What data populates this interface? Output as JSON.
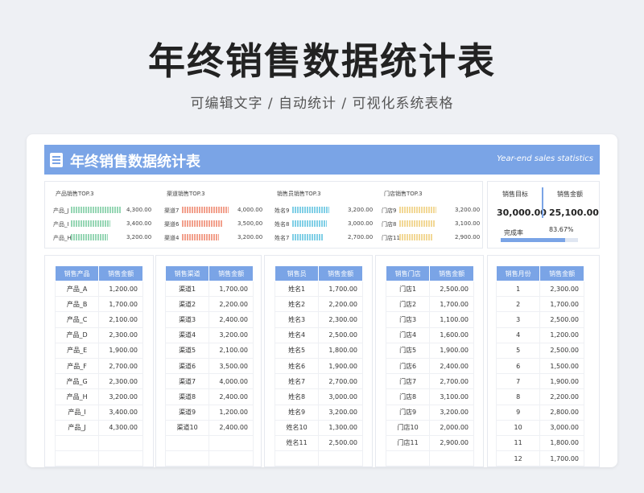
{
  "hero": {
    "title": "年终销售数据统计表",
    "subtitle": "可编辑文字 / 自动统计 / 可视化系统表格"
  },
  "banner": {
    "title": "年终销售数据统计表",
    "subtitle_en": "Year-end sales statistics",
    "icon": "report-icon",
    "color": "#7aa4e6"
  },
  "top_charts": [
    {
      "title": "产品销售TOP.3",
      "color": "#96d6b4",
      "items": [
        {
          "label": "产品_J",
          "value": "4,300.00",
          "amount": 4300
        },
        {
          "label": "产品_I",
          "value": "3,400.00",
          "amount": 3400
        },
        {
          "label": "产品_H",
          "value": "3,200.00",
          "amount": 3200
        }
      ]
    },
    {
      "title": "渠道销售TOP.3",
      "color": "#f2a08c",
      "items": [
        {
          "label": "渠道7",
          "value": "4,000.00",
          "amount": 4000
        },
        {
          "label": "渠道6",
          "value": "3,500,00",
          "amount": 3500
        },
        {
          "label": "渠道4",
          "value": "3,200.00",
          "amount": 3200
        }
      ]
    },
    {
      "title": "销售员销售TOP.3",
      "color": "#80cfe6",
      "items": [
        {
          "label": "姓名9",
          "value": "3,200.00",
          "amount": 3200
        },
        {
          "label": "姓名8",
          "value": "3,000.00",
          "amount": 3000
        },
        {
          "label": "姓名7",
          "value": "2,700.00",
          "amount": 2700
        }
      ]
    },
    {
      "title": "门店销售TOP.3",
      "color": "#f2d896",
      "items": [
        {
          "label": "门店9",
          "value": "3,200.00",
          "amount": 3200
        },
        {
          "label": "门店8",
          "value": "3,100.00",
          "amount": 3100
        },
        {
          "label": "门店11",
          "value": "2,900.00",
          "amount": 2900
        }
      ]
    }
  ],
  "kpi": {
    "target_label": "销售目标",
    "target_value": "30,000.00",
    "amount_label": "销售金额",
    "amount_value": "25,100.00",
    "rate_label": "完成率",
    "rate_value": "83.67%",
    "rate_fraction": 0.8367
  },
  "tables": [
    {
      "headers": [
        "销售产品",
        "销售金额"
      ],
      "rows": [
        [
          "产品_A",
          "1,200.00"
        ],
        [
          "产品_B",
          "1,700.00"
        ],
        [
          "产品_C",
          "2,100.00"
        ],
        [
          "产品_D",
          "2,300.00"
        ],
        [
          "产品_E",
          "1,900.00"
        ],
        [
          "产品_F",
          "2,700.00"
        ],
        [
          "产品_G",
          "2,300.00"
        ],
        [
          "产品_H",
          "3,200.00"
        ],
        [
          "产品_I",
          "3,400.00"
        ],
        [
          "产品_J",
          "4,300.00"
        ],
        [
          "",
          ""
        ],
        [
          "",
          ""
        ]
      ]
    },
    {
      "headers": [
        "销售渠道",
        "销售金额"
      ],
      "rows": [
        [
          "渠道1",
          "1,700.00"
        ],
        [
          "渠道2",
          "2,200.00"
        ],
        [
          "渠道3",
          "2,400.00"
        ],
        [
          "渠道4",
          "3,200.00"
        ],
        [
          "渠道5",
          "2,100.00"
        ],
        [
          "渠道6",
          "3,500.00"
        ],
        [
          "渠道7",
          "4,000.00"
        ],
        [
          "渠道8",
          "2,400.00"
        ],
        [
          "渠道9",
          "1,200.00"
        ],
        [
          "渠道10",
          "2,400.00"
        ],
        [
          "",
          ""
        ],
        [
          "",
          ""
        ]
      ]
    },
    {
      "headers": [
        "销售员",
        "销售金额"
      ],
      "rows": [
        [
          "姓名1",
          "1,700.00"
        ],
        [
          "姓名2",
          "2,200.00"
        ],
        [
          "姓名3",
          "2,300.00"
        ],
        [
          "姓名4",
          "2,500.00"
        ],
        [
          "姓名5",
          "1,800.00"
        ],
        [
          "姓名6",
          "1,900.00"
        ],
        [
          "姓名7",
          "2,700.00"
        ],
        [
          "姓名8",
          "3,000.00"
        ],
        [
          "姓名9",
          "3,200.00"
        ],
        [
          "姓名10",
          "1,300.00"
        ],
        [
          "姓名11",
          "2,500.00"
        ],
        [
          "",
          ""
        ]
      ]
    },
    {
      "headers": [
        "销售门店",
        "销售金额"
      ],
      "rows": [
        [
          "门店1",
          "2,500.00"
        ],
        [
          "门店2",
          "1,700.00"
        ],
        [
          "门店3",
          "1,100.00"
        ],
        [
          "门店4",
          "1,600.00"
        ],
        [
          "门店5",
          "1,900.00"
        ],
        [
          "门店6",
          "2,400.00"
        ],
        [
          "门店7",
          "2,700.00"
        ],
        [
          "门店8",
          "3,100.00"
        ],
        [
          "门店9",
          "3,200.00"
        ],
        [
          "门店10",
          "2,000.00"
        ],
        [
          "门店11",
          "2,900.00"
        ],
        [
          "",
          ""
        ]
      ]
    },
    {
      "headers": [
        "销售月份",
        "销售金额"
      ],
      "rows": [
        [
          "1",
          "2,300.00"
        ],
        [
          "2",
          "1,700.00"
        ],
        [
          "3",
          "2,500.00"
        ],
        [
          "4",
          "1,200.00"
        ],
        [
          "5",
          "2,500.00"
        ],
        [
          "6",
          "1,500.00"
        ],
        [
          "7",
          "1,900.00"
        ],
        [
          "8",
          "2,200.00"
        ],
        [
          "9",
          "2,800.00"
        ],
        [
          "10",
          "3,000.00"
        ],
        [
          "11",
          "1,800.00"
        ],
        [
          "12",
          "1,700.00"
        ]
      ]
    }
  ]
}
